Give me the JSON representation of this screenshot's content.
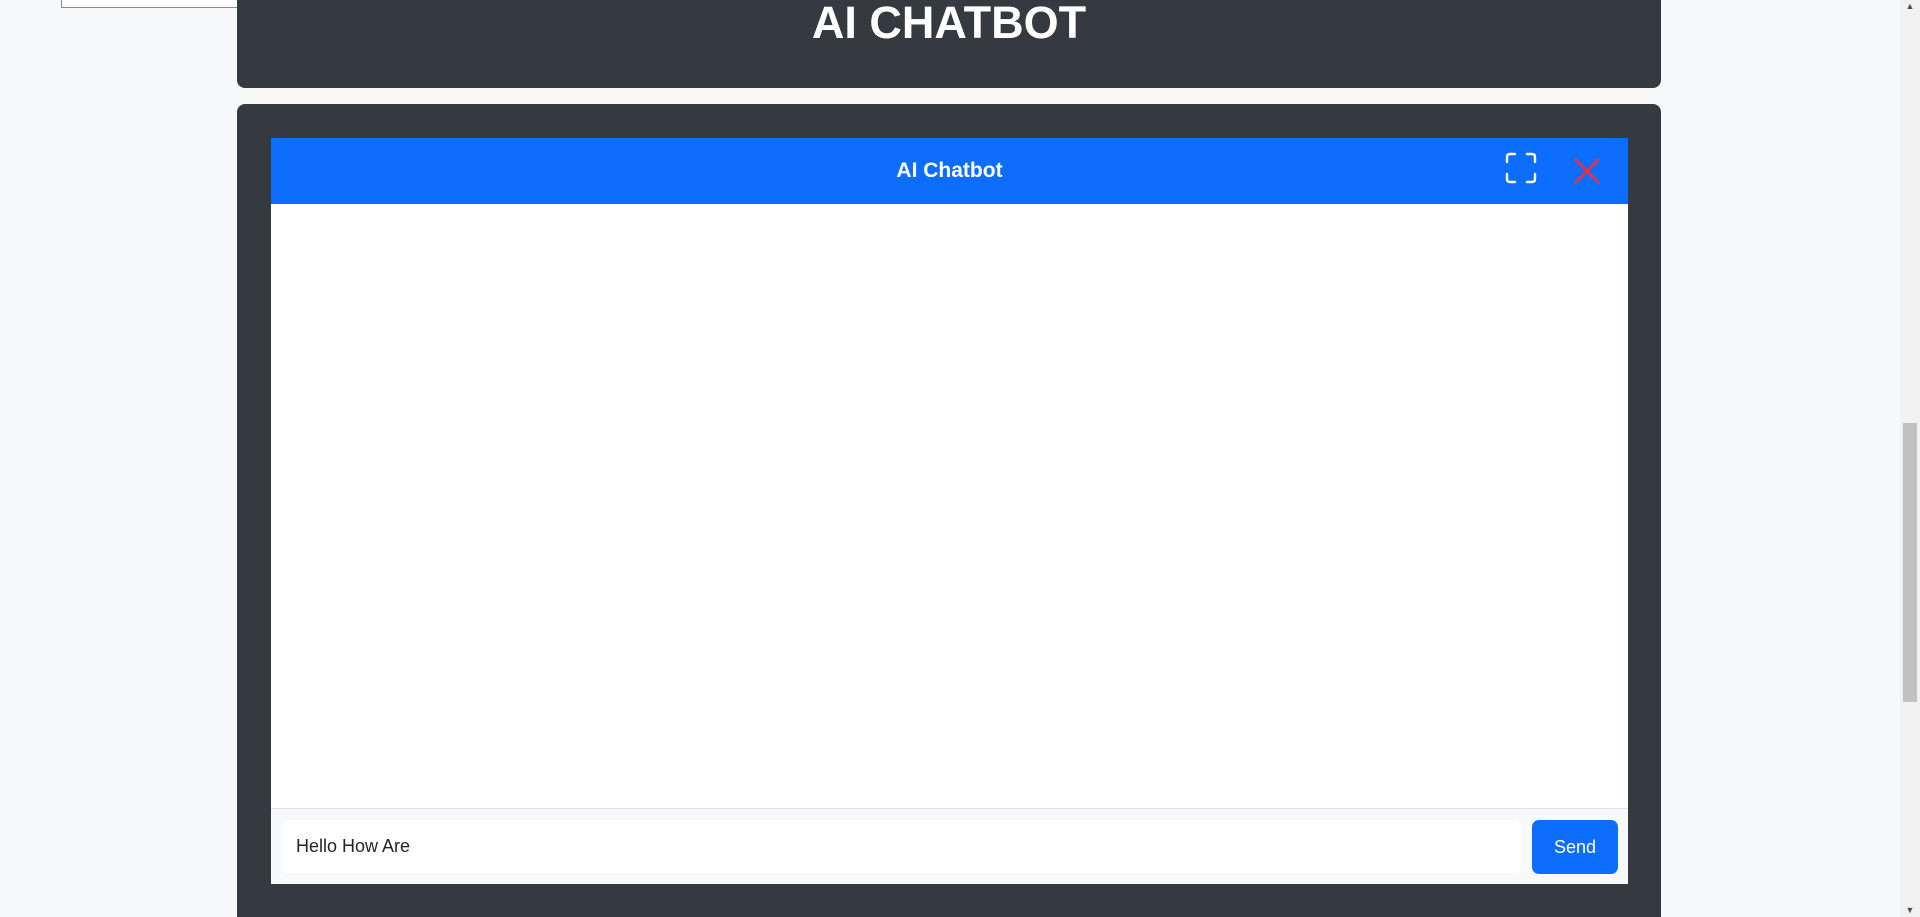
{
  "page": {
    "heading": "AI CHATBOT"
  },
  "chat": {
    "title": "AI Chatbot",
    "input_value": "Hello How Are",
    "send_label": "Send"
  },
  "icons": {
    "expand": "fullscreen-icon",
    "close": "close-icon",
    "scroll_up": "▲",
    "scroll_down": "▼"
  },
  "colors": {
    "card_dark": "#343a40",
    "primary": "#0d6efd",
    "close_red": "#dc3545",
    "page_bg": "#f8f9fa"
  }
}
